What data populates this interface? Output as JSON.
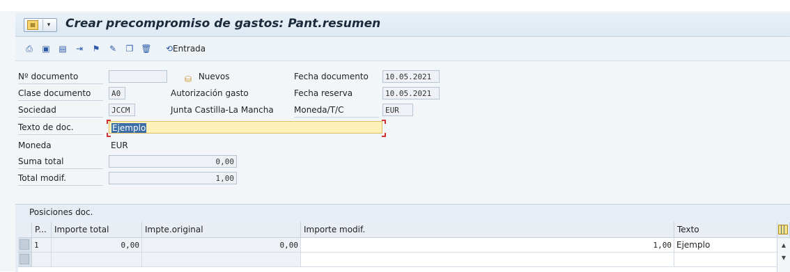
{
  "window": {
    "title": "Crear precompromiso de gastos: Pant.resumen"
  },
  "toolbar": {
    "icons": [
      "print-icon",
      "save-icon",
      "document-icon",
      "document-out-icon",
      "tree-icon",
      "edit-icon",
      "copy-icon",
      "delete-icon"
    ],
    "entrada_label": "Entrada"
  },
  "form": {
    "n_documento": {
      "label": "Nº documento",
      "value": ""
    },
    "nuevos_label": "Nuevos",
    "fecha_documento": {
      "label": "Fecha documento",
      "value": "10.05.2021"
    },
    "clase_documento": {
      "label": "Clase documento",
      "value": "A0",
      "desc": "Autorización gasto"
    },
    "fecha_reserva": {
      "label": "Fecha reserva",
      "value": "10.05.2021"
    },
    "sociedad": {
      "label": "Sociedad",
      "value": "JCCM",
      "desc": "Junta Castilla-La Mancha"
    },
    "moneda_tc": {
      "label": "Moneda/T/C",
      "value": "EUR"
    },
    "texto_doc": {
      "label": "Texto de doc.",
      "value": "Ejemplo"
    },
    "moneda": {
      "label": "Moneda",
      "value": "EUR"
    },
    "suma_total": {
      "label": "Suma total",
      "value": "0,00"
    },
    "total_modif": {
      "label": "Total modif.",
      "value": "1,00"
    }
  },
  "positions": {
    "title": "Posiciones doc.",
    "columns": [
      "P...",
      "Importe total",
      "Impte.original",
      "Importe modif.",
      "Texto"
    ],
    "rows": [
      {
        "pos": "1",
        "importe_total": "0,00",
        "impte_original": "0,00",
        "importe_modif": "1,00",
        "texto": "Ejemplo"
      },
      {
        "pos": "",
        "importe_total": "",
        "impte_original": "",
        "importe_modif": "",
        "texto": ""
      }
    ]
  }
}
